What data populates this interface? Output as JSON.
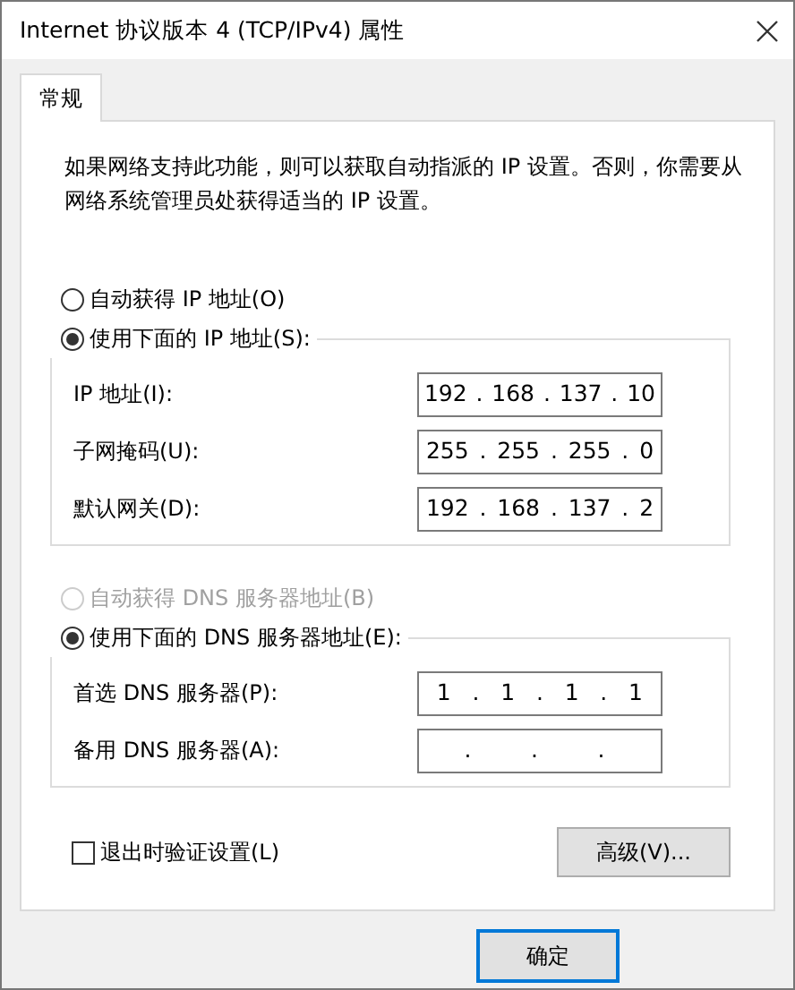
{
  "window": {
    "title": "Internet 协议版本 4 (TCP/IPv4) 属性"
  },
  "tabs": [
    {
      "label": "常规",
      "selected": true
    }
  ],
  "description": "如果网络支持此功能，则可以获取自动指派的 IP 设置。否则，你需要从网络系统管理员处获得适当的 IP 设置。",
  "ip_options": [
    {
      "label": "自动获得 IP 地址(O)",
      "selected": false,
      "disabled": false
    },
    {
      "label": "使用下面的 IP 地址(S):",
      "selected": true,
      "disabled": false
    }
  ],
  "ip_fields": [
    {
      "label": "IP 地址(I):",
      "value": "192 . 168 . 137 . 10"
    },
    {
      "label": "子网掩码(U):",
      "value": "255 . 255 . 255 . 0"
    },
    {
      "label": "默认网关(D):",
      "value": "192 . 168 . 137 . 2"
    }
  ],
  "dns_options": [
    {
      "label": "自动获得 DNS 服务器地址(B)",
      "selected": false,
      "disabled": true
    },
    {
      "label": "使用下面的 DNS 服务器地址(E):",
      "selected": true,
      "disabled": false
    }
  ],
  "dns_fields": [
    {
      "label": "首选 DNS 服务器(P):",
      "value": "1 . 1 . 1 . 1"
    },
    {
      "label": "备用 DNS 服务器(A):",
      "value": ". . ."
    }
  ],
  "validate_checkbox": {
    "label": "退出时验证设置(L)",
    "checked": false
  },
  "advanced_button": "高级(V)...",
  "footer_buttons": [
    {
      "label": "确定",
      "default": true
    }
  ]
}
